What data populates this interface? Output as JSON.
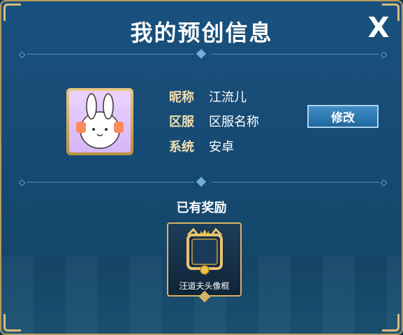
{
  "dialog": {
    "title": "我的预创信息",
    "close_label": "X"
  },
  "profile": {
    "avatar_icon": "bunny-avatar-icon",
    "fields": [
      {
        "label": "昵称",
        "value": "江流儿"
      },
      {
        "label": "区服",
        "value": "区服名称"
      },
      {
        "label": "系统",
        "value": "安卓"
      }
    ],
    "edit_label": "修改"
  },
  "rewards": {
    "title": "已有奖励",
    "items": [
      {
        "name": "汪道夫头像框",
        "icon": "cat-avatar-frame-icon"
      }
    ]
  },
  "colors": {
    "panel": "#174a73",
    "gold": "#d6b064",
    "label": "#f2dfae",
    "button": "#2c78b2"
  }
}
